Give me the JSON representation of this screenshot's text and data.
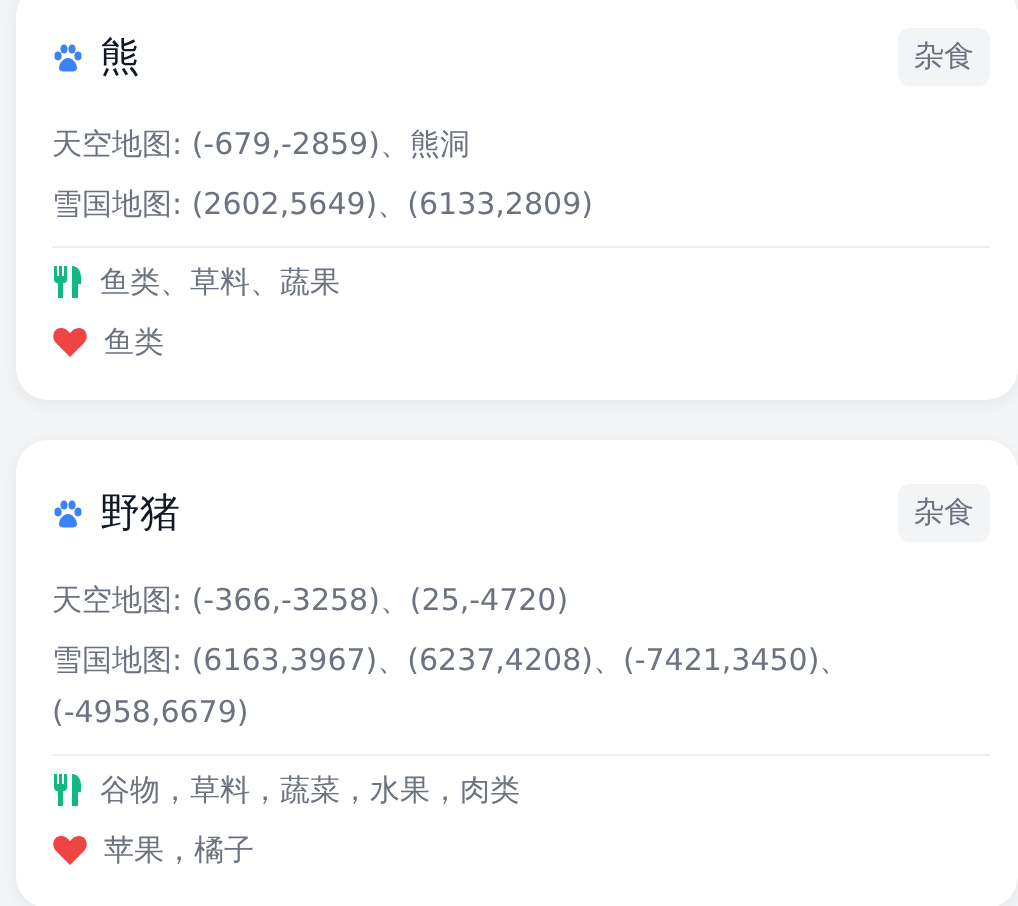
{
  "cards": [
    {
      "name": "熊",
      "tag": "杂食",
      "locations": [
        "天空地图: (-679,-2859)、熊洞",
        "雪国地图: (2602,5649)、(6133,2809)"
      ],
      "diet": "鱼类、草料、蔬果",
      "favorite": "鱼类"
    },
    {
      "name": "野猪",
      "tag": "杂食",
      "locations": [
        "天空地图: (-366,-3258)、(25,-4720)",
        "雪国地图: (6163,3967)、(6237,4208)、(-7421,3450)、(-4958,6679)"
      ],
      "diet": "谷物，草料，蔬菜，水果，肉类",
      "favorite": "苹果，橘子"
    }
  ]
}
